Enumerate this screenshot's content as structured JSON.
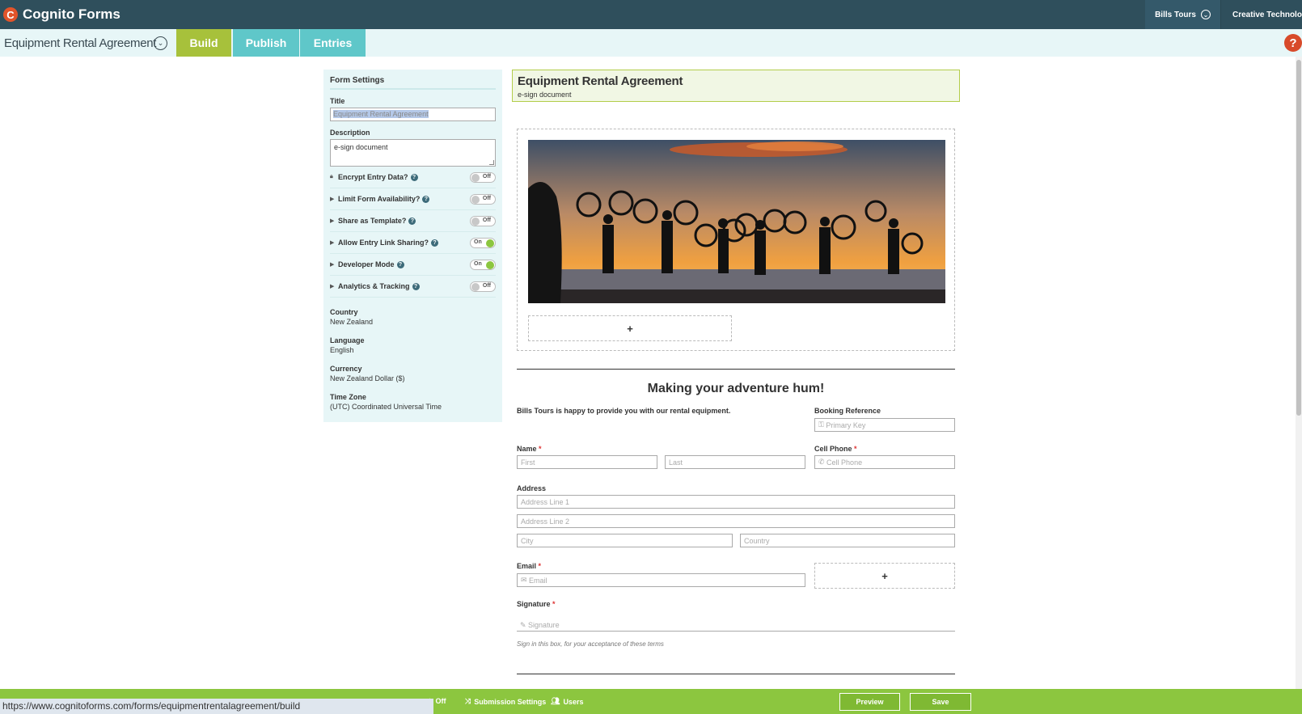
{
  "app": {
    "name": "Cognito Forms",
    "logo_letter": "C"
  },
  "topbar": {
    "org_switch": "Bills Tours",
    "org_name": "Creative Technology"
  },
  "formbar": {
    "form_title": "Equipment Rental Agreement",
    "tabs": [
      {
        "label": "Build",
        "active": true
      },
      {
        "label": "Publish",
        "active": false
      },
      {
        "label": "Entries",
        "active": false
      }
    ],
    "help": "?"
  },
  "settings": {
    "heading": "Form Settings",
    "title_label": "Title",
    "title_value": "Equipment Rental Agreement",
    "description_label": "Description",
    "description_value": "e-sign document",
    "options": [
      {
        "label": "Encrypt Entry Data?",
        "state": "Off",
        "icon": "lock-icon"
      },
      {
        "label": "Limit Form Availability?",
        "state": "Off",
        "icon": "expand-arrow-icon"
      },
      {
        "label": "Share as Template?",
        "state": "Off",
        "icon": "expand-arrow-icon"
      },
      {
        "label": "Allow Entry Link Sharing?",
        "state": "On",
        "icon": "expand-arrow-icon"
      },
      {
        "label": "Developer Mode",
        "state": "On",
        "icon": "expand-arrow-icon"
      },
      {
        "label": "Analytics & Tracking",
        "state": "Off",
        "icon": "expand-arrow-icon"
      }
    ],
    "country_label": "Country",
    "country_value": "New Zealand",
    "language_label": "Language",
    "language_value": "English",
    "currency_label": "Currency",
    "currency_value": "New Zealand Dollar ($)",
    "timezone_label": "Time Zone",
    "timezone_value": "(UTC) Coordinated Universal Time"
  },
  "form": {
    "title": "Equipment Rental Agreement",
    "description": "e-sign document",
    "add_symbol": "+",
    "heading": "Making your adventure hum!",
    "intro": "Bills Tours is happy to provide you with our rental equipment.",
    "booking_label": "Booking Reference",
    "booking_placeholder": "Primary Key",
    "name_label": "Name",
    "first_placeholder": "First",
    "last_placeholder": "Last",
    "phone_label": "Cell Phone",
    "phone_placeholder": "Cell Phone",
    "address_label": "Address",
    "address1_placeholder": "Address Line 1",
    "address2_placeholder": "Address Line 2",
    "city_placeholder": "City",
    "country_placeholder": "Country",
    "email_label": "Email",
    "email_placeholder": "Email",
    "signature_label": "Signature",
    "signature_placeholder": "Signature",
    "signature_help": "Sign in this box, for your acceptance of these terms",
    "required_mark": "*"
  },
  "bottombar": {
    "item_partial": "t: Off",
    "submission_settings": "Submission Settings",
    "users": "Users",
    "preview": "Preview",
    "save": "Save"
  },
  "status_url": "https://www.cognitoforms.com/forms/equipmentrentalagreement/build",
  "colors": {
    "topbar": "#2f4f5c",
    "accent_green": "#a7c13b",
    "accent_teal": "#5fc7c9",
    "bottom_green": "#8cc63f",
    "help_red": "#d84a2a"
  }
}
